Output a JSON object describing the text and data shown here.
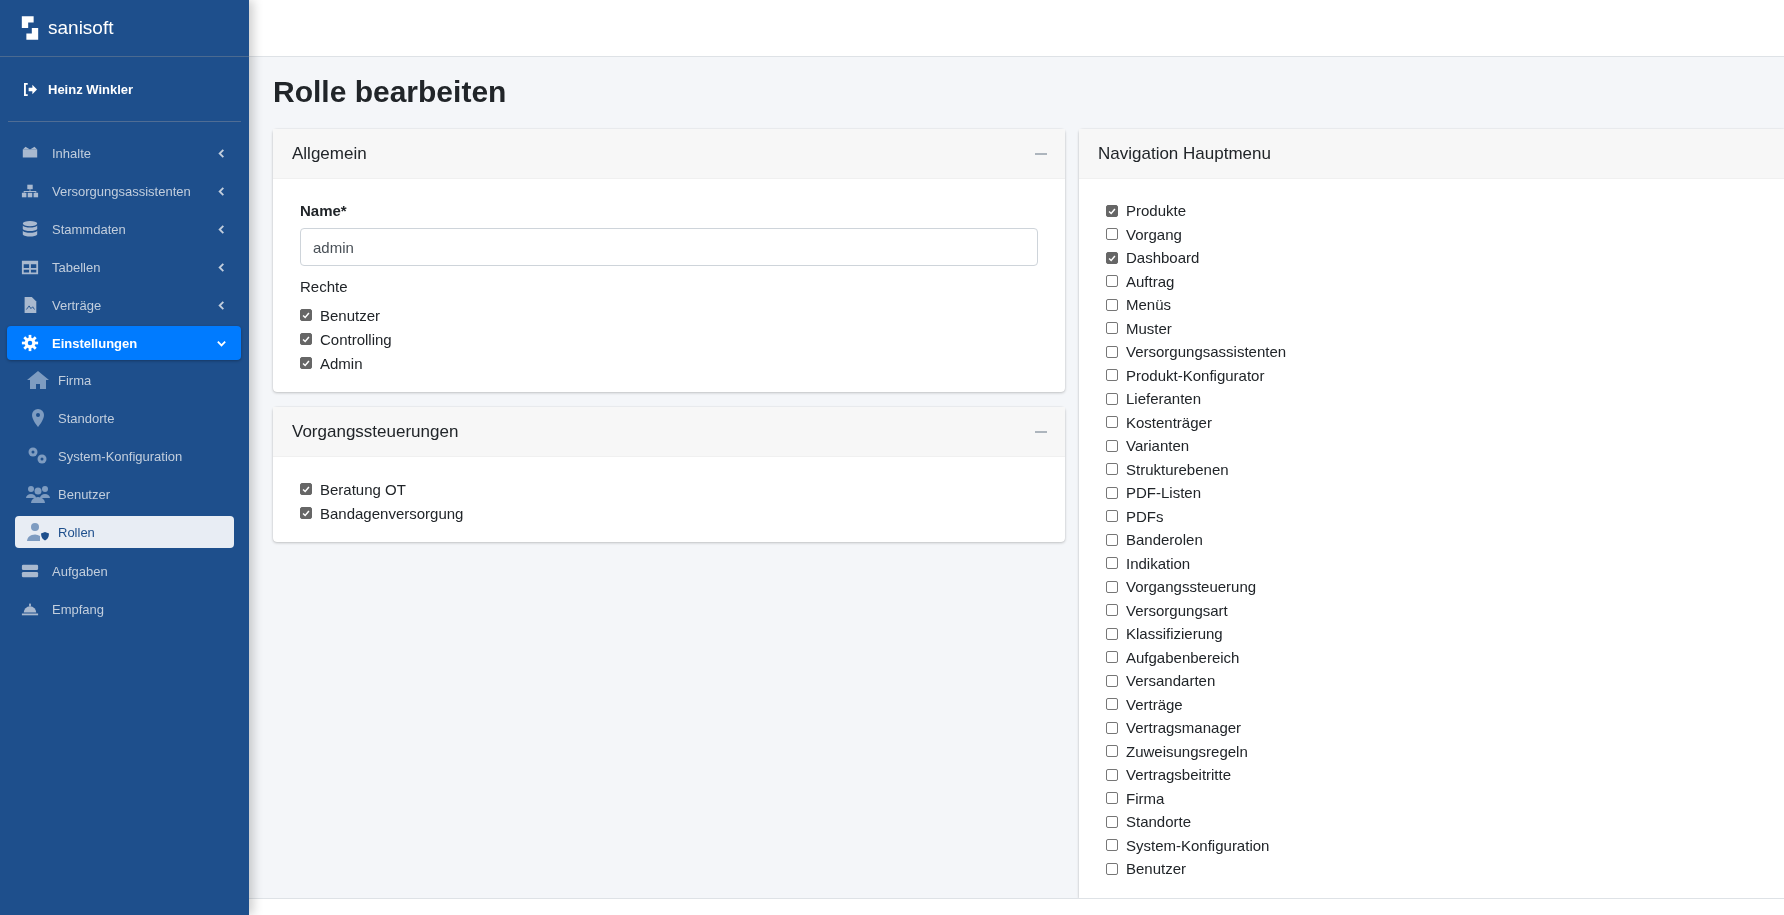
{
  "sidebar": {
    "brand": "sanisoft",
    "user": "Heinz Winkler",
    "menu": [
      {
        "label": "Inhalte",
        "kind": "group",
        "selected": false
      },
      {
        "label": "Versorgungsassistenten",
        "kind": "group",
        "selected": false
      },
      {
        "label": "Stammdaten",
        "kind": "group",
        "selected": false
      },
      {
        "label": "Tabellen",
        "kind": "group",
        "selected": false
      },
      {
        "label": "Verträge",
        "kind": "group",
        "selected": false
      },
      {
        "label": "Einstellungen",
        "kind": "group",
        "selected": true,
        "children": [
          {
            "label": "Firma",
            "selected": false
          },
          {
            "label": "Standorte",
            "selected": false
          },
          {
            "label": "System-Konfiguration",
            "selected": false
          },
          {
            "label": "Benutzer",
            "selected": false
          },
          {
            "label": "Rollen",
            "selected": true
          }
        ]
      },
      {
        "label": "Aufgaben",
        "kind": "link",
        "selected": false
      },
      {
        "label": "Empfang",
        "kind": "link",
        "selected": false
      }
    ]
  },
  "page": {
    "title": "Rolle bearbeiten"
  },
  "general_card": {
    "title": "Allgemein",
    "name_label": "Name*",
    "name_value": "admin",
    "rights_label": "Rechte",
    "rights": [
      {
        "label": "Benutzer",
        "checked": true
      },
      {
        "label": "Controlling",
        "checked": true
      },
      {
        "label": "Admin",
        "checked": true
      }
    ]
  },
  "process_card": {
    "title": "Vorgangssteuerungen",
    "options": [
      {
        "label": "Beratung OT",
        "checked": true
      },
      {
        "label": "Bandagenversorgung",
        "checked": true
      }
    ]
  },
  "navigation_card": {
    "title": "Navigation Hauptmenu",
    "options": [
      {
        "label": "Produkte",
        "checked": true
      },
      {
        "label": "Vorgang",
        "checked": false
      },
      {
        "label": "Dashboard",
        "checked": true
      },
      {
        "label": "Auftrag",
        "checked": false
      },
      {
        "label": "Menüs",
        "checked": false
      },
      {
        "label": "Muster",
        "checked": false
      },
      {
        "label": "Versorgungsassistenten",
        "checked": false
      },
      {
        "label": "Produkt-Konfigurator",
        "checked": false
      },
      {
        "label": "Lieferanten",
        "checked": false
      },
      {
        "label": "Kostenträger",
        "checked": false
      },
      {
        "label": "Varianten",
        "checked": false
      },
      {
        "label": "Strukturebenen",
        "checked": false
      },
      {
        "label": "PDF-Listen",
        "checked": false
      },
      {
        "label": "PDFs",
        "checked": false
      },
      {
        "label": "Banderolen",
        "checked": false
      },
      {
        "label": "Indikation",
        "checked": false
      },
      {
        "label": "Vorgangssteuerung",
        "checked": false
      },
      {
        "label": "Versorgungsart",
        "checked": false
      },
      {
        "label": "Klassifizierung",
        "checked": false
      },
      {
        "label": "Aufgabenbereich",
        "checked": false
      },
      {
        "label": "Versandarten",
        "checked": false
      },
      {
        "label": "Verträge",
        "checked": false
      },
      {
        "label": "Vertragsmanager",
        "checked": false
      },
      {
        "label": "Zuweisungsregeln",
        "checked": false
      },
      {
        "label": "Vertragsbeitritte",
        "checked": false
      },
      {
        "label": "Firma",
        "checked": false
      },
      {
        "label": "Standorte",
        "checked": false
      },
      {
        "label": "System-Konfiguration",
        "checked": false
      },
      {
        "label": "Benutzer",
        "checked": false
      }
    ]
  }
}
